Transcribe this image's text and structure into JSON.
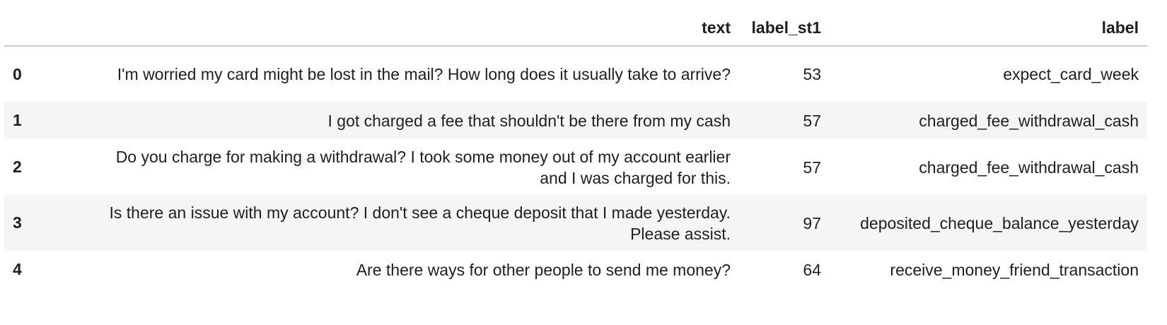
{
  "table": {
    "columns": [
      "",
      "text",
      "label_st1",
      "label"
    ],
    "rows": [
      {
        "index": "0",
        "text": "I'm worried my card might be lost in the mail? How long does it usually take to arrive?",
        "label_st1": "53",
        "label": "expect_card_week"
      },
      {
        "index": "1",
        "text": "I got charged a fee that shouldn't be there from my cash",
        "label_st1": "57",
        "label": "charged_fee_withdrawal_cash"
      },
      {
        "index": "2",
        "text": "Do you charge for making a withdrawal? I took some money out of my account earlier and I was charged for this.",
        "label_st1": "57",
        "label": "charged_fee_withdrawal_cash"
      },
      {
        "index": "3",
        "text": "Is there an issue with my account? I don't see a cheque deposit that I made yesterday. Please assist.",
        "label_st1": "97",
        "label": "deposited_cheque_balance_yesterday"
      },
      {
        "index": "4",
        "text": "Are there ways for other people to send me money?",
        "label_st1": "64",
        "label": "receive_money_friend_transaction"
      }
    ]
  }
}
